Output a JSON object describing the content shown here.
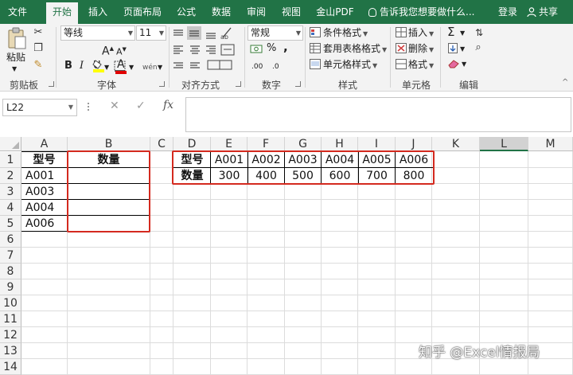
{
  "tabs": [
    "文件",
    "开始",
    "插入",
    "页面布局",
    "公式",
    "数据",
    "审阅",
    "视图",
    "金山PDF"
  ],
  "active_tab": "开始",
  "tell_me": "告诉我您想要做什么...",
  "login": "登录",
  "share": "共享",
  "ribbon": {
    "clipboard": {
      "paste": "粘贴",
      "label": "剪贴板"
    },
    "font": {
      "name": "等线",
      "size": "11",
      "label": "字体",
      "bold": "B",
      "italic": "I",
      "underline": "U",
      "grow": "A",
      "shrink": "A",
      "color_a": "A",
      "wen": "wén"
    },
    "alignment": {
      "label": "对齐方式"
    },
    "number": {
      "format": "常规",
      "label": "数字",
      "percent": "%",
      "comma": ","
    },
    "styles": {
      "conditional": "条件格式",
      "table": "套用表格格式",
      "cell": "单元格样式",
      "label": "样式"
    },
    "cells": {
      "insert": "插入",
      "delete": "删除",
      "format": "格式",
      "label": "单元格"
    },
    "editing": {
      "label": "编辑",
      "sigma": "Σ"
    }
  },
  "formula_bar": {
    "name_box": "L22",
    "fx": "fx",
    "value": ""
  },
  "columns": [
    "A",
    "B",
    "C",
    "D",
    "E",
    "F",
    "G",
    "H",
    "I",
    "J",
    "K",
    "L",
    "M"
  ],
  "selected_column": "L",
  "rows": [
    "1",
    "2",
    "3",
    "4",
    "5",
    "6",
    "7",
    "8",
    "9",
    "10",
    "11",
    "12",
    "13",
    "14"
  ],
  "left_table": {
    "header": [
      "型号",
      "数量"
    ],
    "rows": [
      [
        "A001",
        ""
      ],
      [
        "A003",
        ""
      ],
      [
        "A004",
        ""
      ],
      [
        "A006",
        ""
      ]
    ]
  },
  "right_table": {
    "row1": [
      "型号",
      "A001",
      "A002",
      "A003",
      "A004",
      "A005",
      "A006"
    ],
    "row2": [
      "数量",
      "300",
      "400",
      "500",
      "600",
      "700",
      "800"
    ]
  },
  "watermark": "知乎 @Excel情报局",
  "colors": {
    "accent": "#217346",
    "highlight_box": "#d42a1f"
  }
}
